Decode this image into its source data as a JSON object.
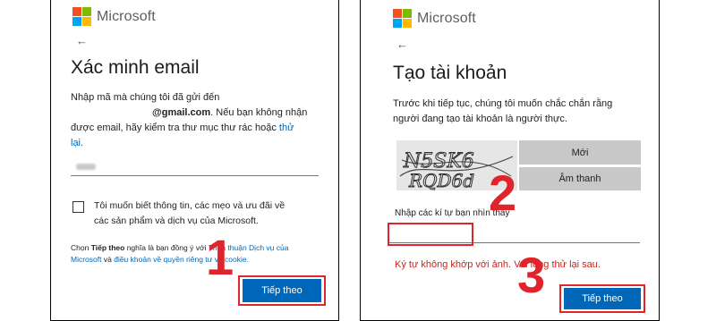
{
  "left": {
    "brand": "Microsoft",
    "back": "←",
    "title": "Xác minh email",
    "desc_line1": "Nhập mã mà chúng tôi đã gửi đến",
    "desc_email": "@gmail.com",
    "desc_line2_rest": ". Nếu bạn không nhận",
    "desc_line3": "được email, hãy kiểm tra thư mục thư rác hoặc",
    "desc_link_a": "thử",
    "desc_link_b": "lại.",
    "checkbox_line1": "Tôi muốn biết thông tin, các mẹo và ưu đãi về",
    "checkbox_line2": "các sản phẩm và dịch vụ của Microsoft.",
    "terms_pre": "Chọn",
    "terms_bold": "Tiếp theo",
    "terms_mid": "nghĩa là bạn đồng ý với",
    "terms_link1": "Thỏa thuận Dịch vụ của",
    "terms_link1b": "Microsoft",
    "terms_and": "và",
    "terms_link2": "điều khoản về quyền riêng tư và cookie.",
    "next_button": "Tiếp theo",
    "step": "1"
  },
  "right": {
    "brand": "Microsoft",
    "back": "←",
    "title": "Tạo tài khoản",
    "desc_line1": "Trước khi tiếp tục, chúng tôi muốn chắc chắn rằng",
    "desc_line2": "người đang tạo tài khoản là người thực.",
    "captcha_text": "N5SK6 RQD6d",
    "new_button": "Mới",
    "audio_button": "Âm thanh",
    "input_label": "Nhập các kí tự bạn nhìn thấy",
    "error": "Ký tự không khớp với ảnh. Vui lòng thử lại sau.",
    "next_button": "Tiếp theo",
    "step2": "2",
    "step3": "3"
  },
  "colors": {
    "accent": "#0067b8",
    "annotation_red": "#e0242c",
    "error_red": "#c4261d"
  }
}
